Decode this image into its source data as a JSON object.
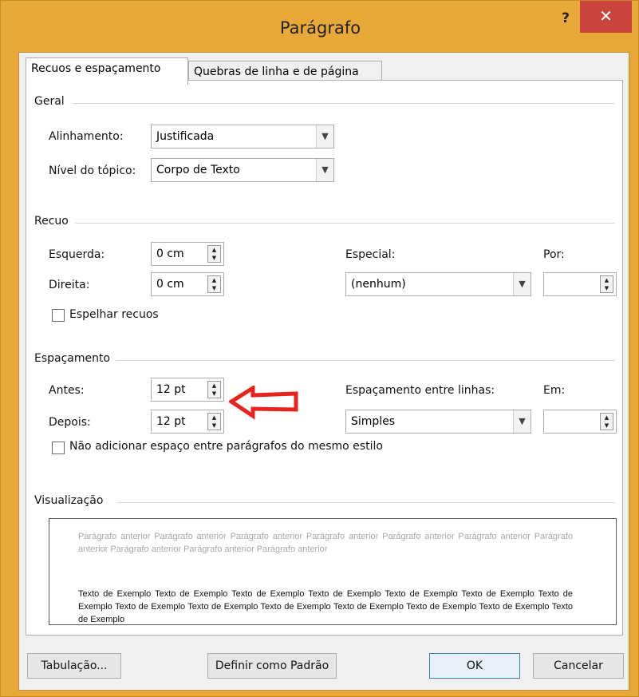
{
  "window": {
    "title": "Parágrafo",
    "help_label": "?",
    "close_label": "✕"
  },
  "tabs": [
    {
      "label": "Recuos e espaçamento",
      "active": true
    },
    {
      "label": "Quebras de linha e de página",
      "active": false
    }
  ],
  "geral": {
    "title": "Geral",
    "alinhamento_label": "Alinhamento:",
    "alinhamento_value": "Justificada",
    "nivel_label": "Nível do tópico:",
    "nivel_value": "Corpo de Texto"
  },
  "recuo": {
    "title": "Recuo",
    "esquerda_label": "Esquerda:",
    "esquerda_value": "0 cm",
    "direita_label": "Direita:",
    "direita_value": "0 cm",
    "especial_label": "Especial:",
    "especial_value": "(nenhum)",
    "por_label": "Por:",
    "por_value": "",
    "espelhar_label": "Espelhar recuos",
    "espelhar_checked": false
  },
  "espacamento": {
    "title": "Espaçamento",
    "antes_label": "Antes:",
    "antes_value": "12 pt",
    "depois_label": "Depois:",
    "depois_value": "12 pt",
    "entre_linhas_label": "Espaçamento entre linhas:",
    "entre_linhas_value": "Simples",
    "em_label": "Em:",
    "em_value": "",
    "nao_adicionar_label": "Não adicionar espaço entre parágrafos do mesmo estilo",
    "nao_adicionar_checked": false
  },
  "visualizacao": {
    "title": "Visualização",
    "previous_text": "Parágrafo anterior Parágrafo anterior Parágrafo anterior Parágrafo anterior Parágrafo anterior Parágrafo anterior Parágrafo anterior Parágrafo anterior Parágrafo anterior Parágrafo anterior",
    "sample_text": "Texto de Exemplo Texto de Exemplo Texto de Exemplo Texto de Exemplo Texto de Exemplo Texto de Exemplo Texto de Exemplo Texto de Exemplo Texto de Exemplo Texto de Exemplo Texto de Exemplo Texto de Exemplo Texto de Exemplo Texto de Exemplo"
  },
  "buttons": {
    "tabulacao": "Tabulação...",
    "definir_padrao": "Definir como Padrão",
    "ok": "OK",
    "cancelar": "Cancelar"
  },
  "colors": {
    "frame": "#e8a838",
    "close": "#c9443d",
    "arrow": "#e8231e"
  },
  "icons": {
    "dropdown": "chevron-down-icon",
    "spinner": "spinner-updown-icon",
    "annotation": "red-arrow-icon"
  }
}
